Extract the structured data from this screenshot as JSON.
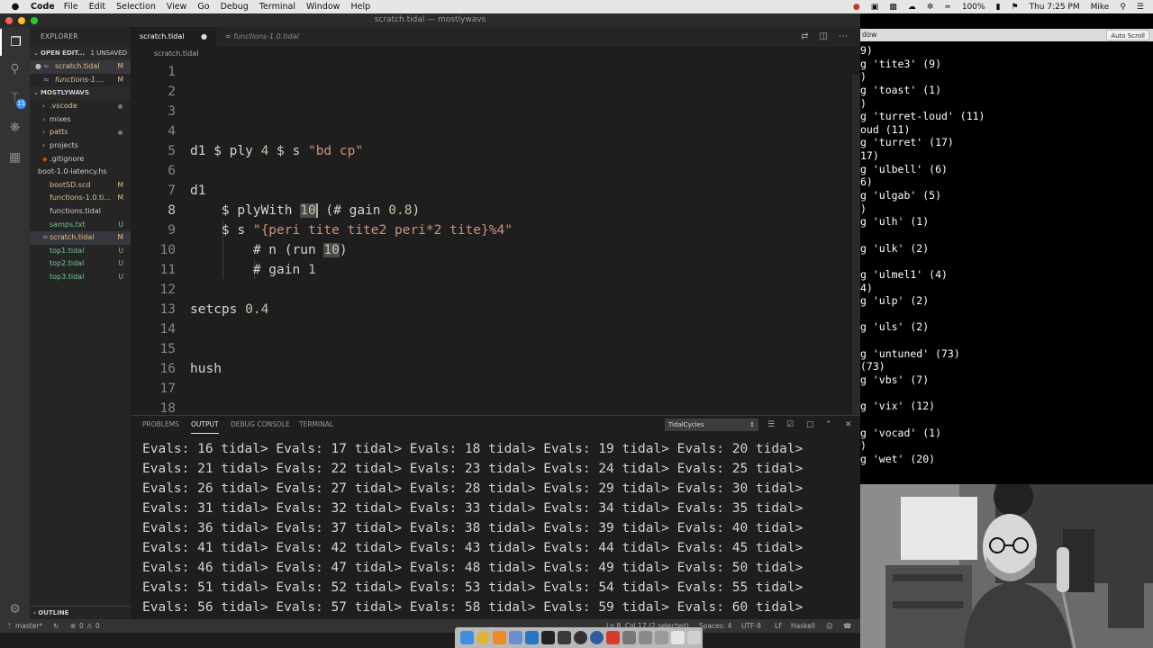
{
  "menubar": {
    "app_name": "Code",
    "items": [
      "File",
      "Edit",
      "Selection",
      "View",
      "Go",
      "Debug",
      "Terminal",
      "Window",
      "Help"
    ],
    "battery": "100%",
    "clock": "Thu 7:25 PM",
    "user": "Mike"
  },
  "window": {
    "title": "scratch.tidal — mostlywavs"
  },
  "sidebar": {
    "header": "EXPLORER",
    "open_editors": {
      "label": "OPEN EDIT...",
      "count": "1 UNSAVED",
      "items": [
        {
          "name": "scratch.tidal",
          "status": "M"
        },
        {
          "name": "functions-1....",
          "status": "M"
        }
      ]
    },
    "folder": {
      "label": "MOSTLYWAVS",
      "items": [
        {
          "name": ".vscode",
          "status": ""
        },
        {
          "name": "mixes",
          "status": ""
        },
        {
          "name": "patts",
          "status": ""
        },
        {
          "name": "projects",
          "status": ""
        },
        {
          "name": ".gitignore",
          "status": ""
        },
        {
          "name": "boot-1.0-latency.hs",
          "status": ""
        },
        {
          "name": "bootSD.scd",
          "status": "M"
        },
        {
          "name": "functions-1.0.ti...",
          "status": "M"
        },
        {
          "name": "functions.tidal",
          "status": ""
        },
        {
          "name": "samps.txt",
          "status": "U"
        },
        {
          "name": "scratch.tidal",
          "status": "M"
        },
        {
          "name": "top1.tidal",
          "status": "U"
        },
        {
          "name": "top2.tidal",
          "status": "U"
        },
        {
          "name": "top3.tidal",
          "status": "U"
        }
      ]
    },
    "outline_label": "OUTLINE",
    "scm_badge": "11"
  },
  "tabs": [
    {
      "label": "scratch.tidal"
    },
    {
      "label": "functions-1.0.tidal"
    }
  ],
  "breadcrumb": "scratch.tidal",
  "code_lines": [
    {
      "n": "1",
      "parts": []
    },
    {
      "n": "2",
      "parts": []
    },
    {
      "n": "3",
      "parts": []
    },
    {
      "n": "4",
      "parts": []
    },
    {
      "n": "5",
      "parts": [
        [
          "p",
          "d1 $ ply "
        ],
        [
          "num",
          "4"
        ],
        [
          "p",
          " $ s "
        ],
        [
          "str",
          "\"bd cp\""
        ]
      ]
    },
    {
      "n": "6",
      "parts": []
    },
    {
      "n": "7",
      "parts": [
        [
          "p",
          "d1"
        ]
      ]
    },
    {
      "n": "8",
      "parts": [
        [
          "p",
          "    $ plyWith "
        ],
        [
          "sel",
          "10"
        ],
        [
          "p",
          " (# gain "
        ],
        [
          "num",
          "0.8"
        ],
        [
          "p",
          ")"
        ]
      ]
    },
    {
      "n": "9",
      "parts": [
        [
          "p",
          "    $ s "
        ],
        [
          "str",
          "\"{peri tite tite2 peri*2 tite}%4\""
        ]
      ]
    },
    {
      "n": "10",
      "parts": [
        [
          "p",
          "        # n (run "
        ],
        [
          "hl",
          "10"
        ],
        [
          "p",
          ")"
        ]
      ]
    },
    {
      "n": "11",
      "parts": [
        [
          "p",
          "        # gain "
        ],
        [
          "num",
          "1"
        ]
      ]
    },
    {
      "n": "12",
      "parts": []
    },
    {
      "n": "13",
      "parts": [
        [
          "p",
          "setcps "
        ],
        [
          "num",
          "0.4"
        ]
      ]
    },
    {
      "n": "14",
      "parts": []
    },
    {
      "n": "15",
      "parts": []
    },
    {
      "n": "16",
      "parts": [
        [
          "p",
          "hush"
        ]
      ]
    },
    {
      "n": "17",
      "parts": []
    },
    {
      "n": "18",
      "parts": []
    }
  ],
  "panel": {
    "tabs": [
      "PROBLEMS",
      "OUTPUT",
      "DEBUG CONSOLE",
      "TERMINAL"
    ],
    "channel": "TidalCycles",
    "output_lines": [
      "Evals: 16 tidal> Evals: 17 tidal> Evals: 18 tidal> Evals: 19 tidal> Evals: 20 tidal>",
      "Evals: 21 tidal> Evals: 22 tidal> Evals: 23 tidal> Evals: 24 tidal> Evals: 25 tidal>",
      "Evals: 26 tidal> Evals: 27 tidal> Evals: 28 tidal> Evals: 29 tidal> Evals: 30 tidal>",
      "Evals: 31 tidal> Evals: 32 tidal> Evals: 33 tidal> Evals: 34 tidal> Evals: 35 tidal>",
      "Evals: 36 tidal> Evals: 37 tidal> Evals: 38 tidal> Evals: 39 tidal> Evals: 40 tidal>",
      "Evals: 41 tidal> Evals: 42 tidal> Evals: 43 tidal> Evals: 44 tidal> Evals: 45 tidal>",
      "Evals: 46 tidal> Evals: 47 tidal> Evals: 48 tidal> Evals: 49 tidal> Evals: 50 tidal>",
      "Evals: 51 tidal> Evals: 52 tidal> Evals: 53 tidal> Evals: 54 tidal> Evals: 55 tidal>",
      "Evals: 56 tidal> Evals: 57 tidal> Evals: 58 tidal> Evals: 59 tidal> Evals: 60 tidal>"
    ]
  },
  "statusbar": {
    "branch": "master*",
    "errors": "0",
    "warnings": "0",
    "position": "Ln 8, Col 17 (2 selected)",
    "spaces": "Spaces: 4",
    "encoding": "UTF-8",
    "eol": "LF",
    "language": "Haskell"
  },
  "log_window": {
    "title": "dow",
    "autoscroll": "Auto Scroll",
    "lines": [
      "9)",
      "g 'tite3' (9)",
      ")",
      "g 'toast' (1)",
      ")",
      "g 'turret-loud' (11)",
      "oud (11)",
      "g 'turret' (17)",
      "17)",
      "g 'ulbell' (6)",
      "6)",
      "g 'ulgab' (5)",
      ")",
      "g 'ulh' (1)",
      "",
      "g 'ulk' (2)",
      "",
      "g 'ulmel1' (4)",
      "4)",
      "g 'ulp' (2)",
      "",
      "g 'uls' (2)",
      "",
      "g 'untuned' (73)",
      "(73)",
      "g 'vbs' (7)",
      "",
      "g 'vix' (12)",
      "",
      "g 'vocad' (1)",
      ")",
      "g 'wet' (20)"
    ]
  },
  "colors": {
    "editor_bg": "#1e1e1e",
    "sidebar_bg": "#252526",
    "activity_bg": "#333333",
    "number": "#b5cea8",
    "string": "#ce9178",
    "modified": "#e2c08d",
    "untracked": "#73c991",
    "accent": "#3794ff"
  }
}
